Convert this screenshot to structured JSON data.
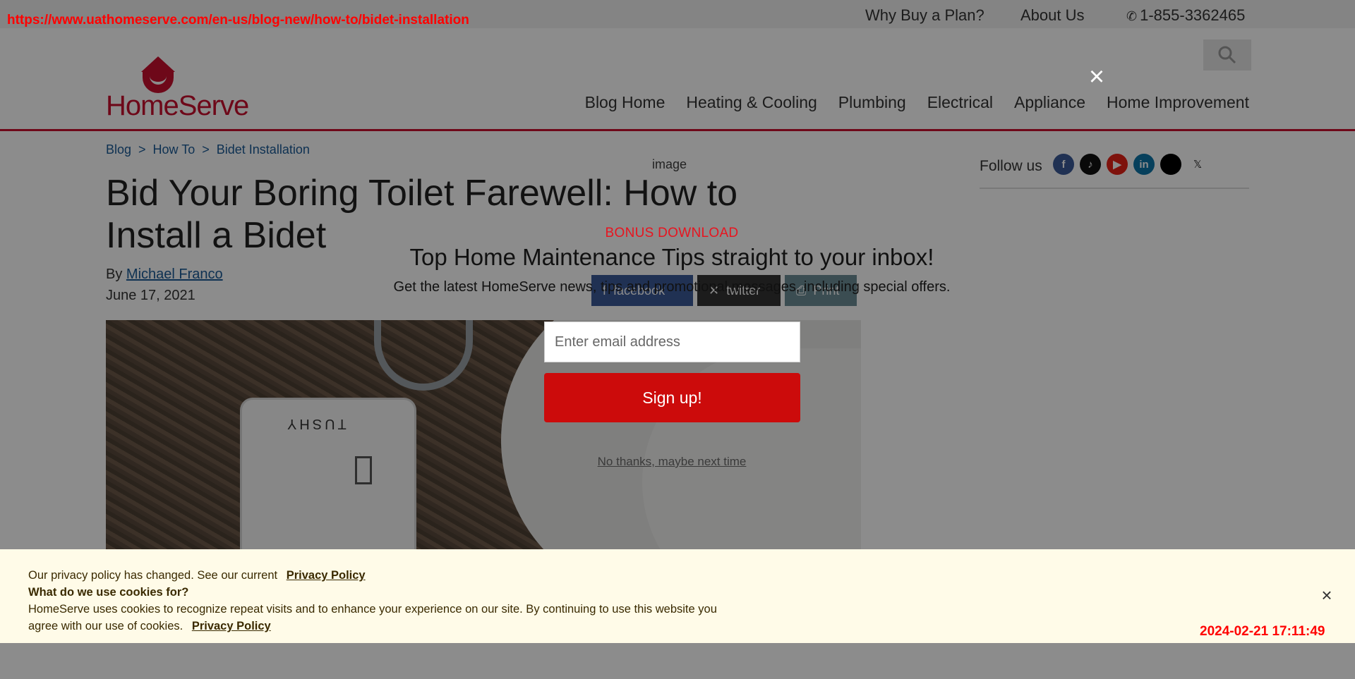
{
  "overlay_text": {
    "url": "https://www.uathomeserve.com/en-us/blog-new/how-to/bidet-installation",
    "timestamp": "2024-02-21 17:11:49"
  },
  "utility_bar": {
    "why_buy": "Why Buy a Plan?",
    "about": "About Us",
    "phone": "1-855-3362465"
  },
  "header": {
    "logo_text": "HomeServe",
    "nav": [
      "Blog Home",
      "Heating & Cooling",
      "Plumbing",
      "Electrical",
      "Appliance",
      "Home Improvement"
    ]
  },
  "breadcrumb": [
    "Blog",
    "How To",
    "Bidet Installation"
  ],
  "article": {
    "title": "Bid Your Boring Toilet Farewell: How to Install a Bidet",
    "by_label": "By",
    "author": "Michael Franco",
    "date": "June 17, 2021",
    "image_brand": "TUSHY"
  },
  "share": {
    "facebook": "facebook",
    "twitter": "twitter",
    "print": "Print"
  },
  "sidebar": {
    "follow_label": "Follow us",
    "x_label": "𝕏"
  },
  "modal": {
    "image_label": "image",
    "kicker": "BONUS DOWNLOAD",
    "heading": "Top Home Maintenance Tips straight to your inbox!",
    "subtext": "Get the latest HomeServe news, tips and promotional messages, including special offers.",
    "email_placeholder": "Enter email address",
    "submit_label": "Sign up!",
    "dismiss_label": "No thanks, maybe next time",
    "close_label": "×"
  },
  "cookie_banner": {
    "line1": "Our privacy policy has changed. See our current",
    "line1_link": "Privacy Policy",
    "line2": "What do we use cookies for?",
    "line3": "HomeServe uses cookies to recognize repeat visits and to enhance your experience on our site. By continuing to use this website you",
    "line4": "agree with our use of cookies.",
    "line4_link": "Privacy Policy",
    "close_label": "×"
  },
  "colors": {
    "brand_red": "#c8102e",
    "link_blue": "#1a5a96",
    "cta_red": "#cc0b0b",
    "cookie_bg": "#fffbe8"
  }
}
